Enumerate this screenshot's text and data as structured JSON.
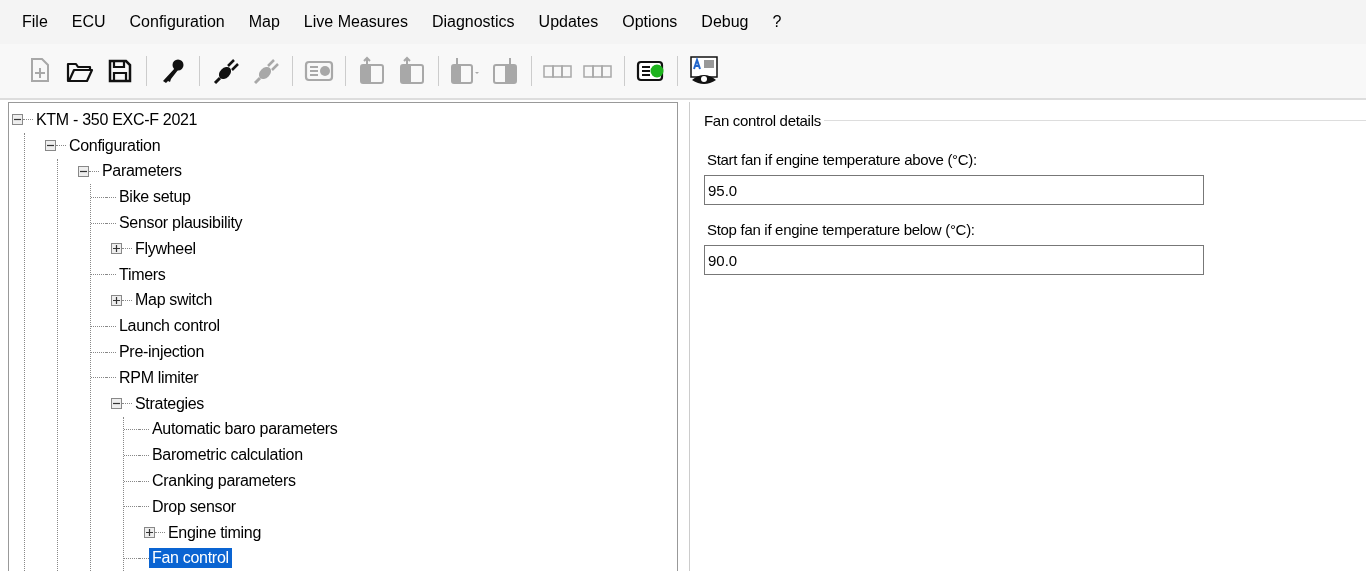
{
  "menu": [
    "File",
    "ECU",
    "Configuration",
    "Map",
    "Live Measures",
    "Diagnostics",
    "Updates",
    "Options",
    "Debug",
    "?"
  ],
  "toolbar": {
    "groups": [
      [
        {
          "kind": "new-file",
          "disabled": true
        },
        {
          "kind": "open-folder",
          "disabled": false
        },
        {
          "kind": "save",
          "disabled": false
        }
      ],
      [
        {
          "kind": "key",
          "disabled": false
        }
      ],
      [
        {
          "kind": "plug",
          "disabled": false
        },
        {
          "kind": "plug",
          "disabled": true
        }
      ],
      [
        {
          "kind": "info-card",
          "disabled": true
        }
      ],
      [
        {
          "kind": "upload",
          "disabled": true
        },
        {
          "kind": "upload",
          "disabled": true
        }
      ],
      [
        {
          "kind": "download-menu",
          "disabled": true
        },
        {
          "kind": "download",
          "disabled": true
        }
      ],
      [
        {
          "kind": "numbers",
          "disabled": true
        },
        {
          "kind": "numbers",
          "disabled": true
        }
      ],
      [
        {
          "kind": "status-card",
          "disabled": false
        }
      ],
      [
        {
          "kind": "preview",
          "disabled": false
        }
      ]
    ]
  },
  "tree": [
    {
      "label": "KTM - 350 EXC-F 2021",
      "expanded": true,
      "selected": false,
      "children": [
        {
          "label": "Configuration",
          "expanded": true,
          "selected": false,
          "children": [
            {
              "label": "Parameters",
              "expanded": true,
              "selected": false,
              "children": [
                {
                  "label": "Bike setup",
                  "selected": false
                },
                {
                  "label": "Sensor plausibility",
                  "selected": false
                },
                {
                  "label": "Flywheel",
                  "expanded": false,
                  "selected": false
                },
                {
                  "label": "Timers",
                  "selected": false
                },
                {
                  "label": "Map switch",
                  "expanded": false,
                  "selected": false
                },
                {
                  "label": "Launch control",
                  "selected": false
                },
                {
                  "label": "Pre-injection",
                  "selected": false
                },
                {
                  "label": "RPM limiter",
                  "selected": false
                },
                {
                  "label": "Strategies",
                  "expanded": true,
                  "selected": false,
                  "children": [
                    {
                      "label": "Automatic baro parameters",
                      "selected": false
                    },
                    {
                      "label": "Barometric calculation",
                      "selected": false
                    },
                    {
                      "label": "Cranking parameters",
                      "selected": false
                    },
                    {
                      "label": "Drop sensor",
                      "selected": false
                    },
                    {
                      "label": "Engine timing",
                      "expanded": false,
                      "selected": false
                    },
                    {
                      "label": "Fan control",
                      "selected": true
                    }
                  ]
                }
              ]
            }
          ]
        }
      ]
    }
  ],
  "details": {
    "title": "Fan control details",
    "fields": [
      {
        "label": "Start fan if engine temperature above (°C):",
        "value": "95.0"
      },
      {
        "label": "Stop fan if engine temperature below (°C):",
        "value": "90.0"
      }
    ]
  }
}
